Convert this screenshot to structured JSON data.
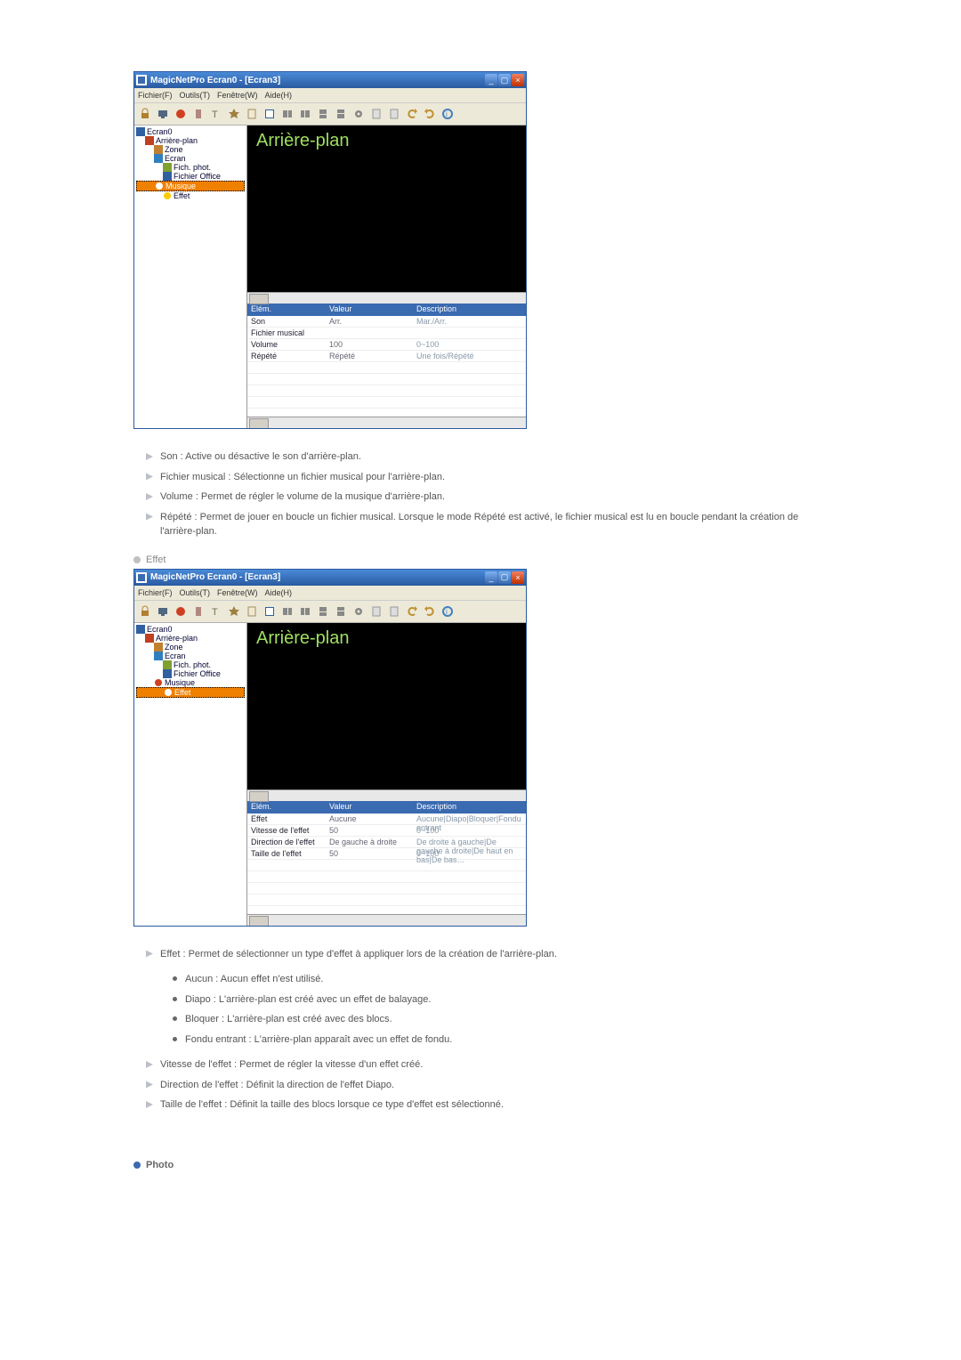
{
  "shared": {
    "window_title": "MagicNetPro Ecran0 - [Ecran3]",
    "menus": [
      "Fichier(F)",
      "Outils(T)",
      "Fenêtre(W)",
      "Aide(H)"
    ],
    "canvas_title": "Arrière-plan",
    "prop_headers": [
      "Elém.",
      "Valeur",
      "Description"
    ],
    "tree": {
      "root": "Ecran0",
      "bg": "Arrière-plan",
      "zone": "Zone",
      "ecran": "Ecran",
      "fich": "Fich. phot.",
      "office": "Fichier Office",
      "musique": "Musique",
      "effet": "Effet"
    }
  },
  "screenshot1": {
    "tree_selected": "Musique",
    "prop_rows": [
      {
        "name": "Son",
        "value": "Arr.",
        "desc": "Mar./Arr."
      },
      {
        "name": "Fichier musical",
        "value": "",
        "desc": ""
      },
      {
        "name": "Volume",
        "value": "100",
        "desc": "0~100"
      },
      {
        "name": "Répété",
        "value": "Répété",
        "desc": "Une fois/Répété"
      }
    ]
  },
  "screenshot2": {
    "tree_selected": "Effet",
    "prop_rows": [
      {
        "name": "Effet",
        "value": "Aucune",
        "desc": "Aucune|Diapo|Bloquer|Fondu entrant"
      },
      {
        "name": "Vitesse de l'effet",
        "value": "50",
        "desc": "0~100"
      },
      {
        "name": "Direction de l'effet",
        "value": "De gauche à droite",
        "desc": "De droite à gauche|De gauche à droite|De haut en bas|De bas…"
      },
      {
        "name": "Taille de l'effet",
        "value": "50",
        "desc": "0~100"
      }
    ]
  },
  "text1": {
    "l1": "Son : Active ou désactive le son d'arrière-plan.",
    "l2": "Fichier musical : Sélectionne un fichier musical pour l'arrière-plan.",
    "l3": "Volume : Permet de régler le volume de la musique d'arrière-plan.",
    "l4": "Répété : Permet de jouer en boucle un fichier musical. Lorsque le mode Répété est activé, le fichier musical est lu en boucle pendant la création de l'arrière-plan."
  },
  "section_effet": "Effet",
  "text2": {
    "l1": "Effet : Permet de sélectionner un type d'effet à appliquer lors de la création de l'arrière-plan.",
    "s1": "Aucun : Aucun effet n'est utilisé.",
    "s2": "Diapo : L'arrière-plan est créé avec un effet de balayage.",
    "s3": "Bloquer : L'arrière-plan est créé avec des blocs.",
    "s4": "Fondu entrant : L'arrière-plan apparaît avec un effet de fondu.",
    "l2": "Vitesse de l'effet : Permet de régler la vitesse d'un effet créé.",
    "l3": "Direction de l'effet : Définit la direction de l'effet Diapo.",
    "l4": "Taille de l'effet : Définit la taille des blocs lorsque ce type d'effet est sélectionné."
  },
  "section_photo": "Photo"
}
